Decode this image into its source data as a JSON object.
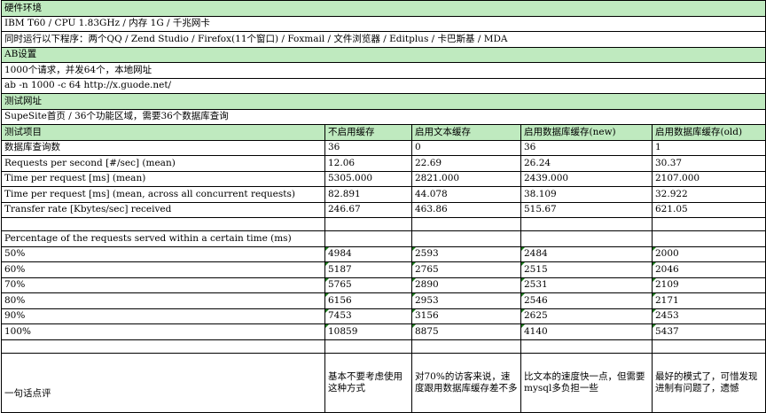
{
  "hardware": {
    "title": "硬件环境",
    "machine": "IBM T60 / CPU 1.83GHz / 内存 1G / 千兆网卡",
    "running": "同时运行以下程序：两个QQ / Zend Studio / Firefox(11个窗口) / Foxmail / 文件浏览器 / Editplus / 卡巴斯基 / MDA"
  },
  "ab": {
    "title": "AB设置",
    "requests": "1000个请求，并发64个，本地网址",
    "command": "ab -n 1000 -c 64 http://x.guode.net/"
  },
  "test_url": {
    "title": "测试网址",
    "desc": "SupeSite首页 / 36个功能区域，需要36个数据库查询"
  },
  "table": {
    "headers": [
      "测试项目",
      "不启用缓存",
      "启用文本缓存",
      "启用数据库缓存(new)",
      "启用数据库缓存(old)"
    ],
    "metrics": [
      {
        "label": "数据库查询数",
        "values": [
          "36",
          "0",
          "36",
          "1"
        ]
      },
      {
        "label": "Requests per second [#/sec] (mean)",
        "values": [
          "12.06",
          "22.69",
          "26.24",
          "30.37"
        ]
      },
      {
        "label": "Time per request [ms] (mean)",
        "values": [
          "5305.000",
          "2821.000",
          "2439.000",
          "2107.000"
        ]
      },
      {
        "label": "Time per request [ms] (mean, across all concurrent requests)",
        "values": [
          "82.891",
          "44.078",
          "38.109",
          "32.922"
        ]
      },
      {
        "label": "Transfer rate [Kbytes/sec] received",
        "values": [
          "246.67",
          "463.86",
          "515.67",
          "621.05"
        ]
      }
    ],
    "percentage_title": "Percentage of the requests served within a certain time (ms)",
    "percentiles": [
      {
        "label": "50%",
        "values": [
          "4984",
          "2593",
          "2484",
          "2000"
        ]
      },
      {
        "label": "60%",
        "values": [
          "5187",
          "2765",
          "2515",
          "2046"
        ]
      },
      {
        "label": "70%",
        "values": [
          "5765",
          "2890",
          "2531",
          "2109"
        ]
      },
      {
        "label": "80%",
        "values": [
          "6156",
          "2953",
          "2546",
          "2171"
        ]
      },
      {
        "label": "90%",
        "values": [
          "7453",
          "3156",
          "2625",
          "2453"
        ]
      },
      {
        "label": "100%",
        "values": [
          "10859",
          "8875",
          "4140",
          "5437"
        ]
      }
    ],
    "comment": {
      "label": "一句话点评",
      "values": [
        "基本不要考虑使用这种方式",
        "对70%的访客来说，速度跟用数据库缓存差不多",
        "比文本的速度快一点，但需要mysql多负担一些",
        "最好的模式了，可惜发现进制有问题了，遗憾"
      ]
    }
  }
}
